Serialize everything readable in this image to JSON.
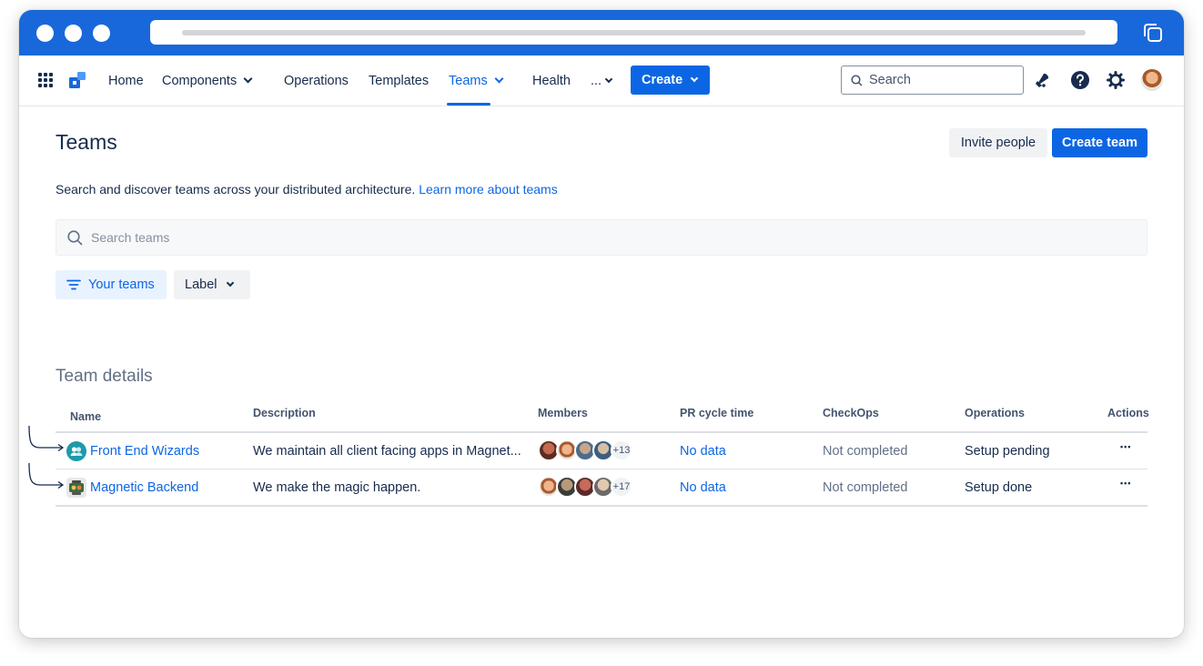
{
  "nav": {
    "items": [
      "Home",
      "Components",
      "Operations",
      "Templates",
      "Teams",
      "Health",
      "..."
    ],
    "active": "Teams",
    "create_label": "Create",
    "search_placeholder": "Search"
  },
  "page": {
    "title": "Teams",
    "invite_label": "Invite people",
    "create_team_label": "Create team",
    "intro_text": "Search and discover teams across your distributed architecture.",
    "intro_link": "Learn more about teams",
    "search_placeholder": "Search teams",
    "filter_your_teams": "Your teams",
    "filter_label": "Label"
  },
  "table": {
    "title": "Team details",
    "columns": [
      "Name",
      "Description",
      "Members",
      "PR cycle time",
      "CheckOps",
      "Operations",
      "Actions"
    ],
    "rows": [
      {
        "name": "Front End Wizards",
        "description": "We maintain all client facing apps in Magnet...",
        "members_extra": "+13",
        "pr_cycle_time": "No data",
        "checkops": "Not completed",
        "operations": "Setup pending",
        "actions": "•••"
      },
      {
        "name": "Magnetic Backend",
        "description": "We make the magic happen.",
        "members_extra": "+17",
        "pr_cycle_time": "No data",
        "checkops": "Not completed",
        "operations": "Setup done",
        "actions": "•••"
      }
    ]
  },
  "colors": {
    "brand": "#1868db",
    "primary": "#0c66e4",
    "text": "#172b4d",
    "muted": "#626f86"
  },
  "icons": [
    "apps-grid-icon",
    "product-logo-icon",
    "chevron-down-icon",
    "search-icon",
    "notification-icon",
    "help-icon",
    "settings-icon",
    "filter-icon",
    "team-icon",
    "more-icon",
    "arrow-icon"
  ]
}
